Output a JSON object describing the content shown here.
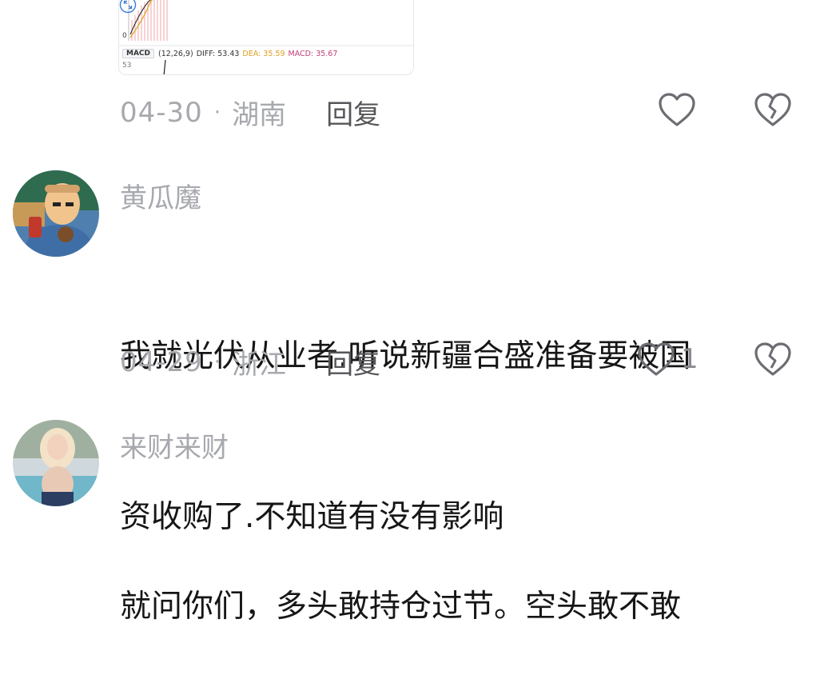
{
  "chart_card": {
    "zero_label": "0",
    "macd_tag": "MACD",
    "macd_params": "(12,26,9)",
    "diff_text": "DIFF: 53.43",
    "dea_text": "DEA: 35.59",
    "macd_text": "MACD: 35.67",
    "low_label": "53"
  },
  "comments": [
    {
      "date": "04-30",
      "location": "湖南",
      "reply_label": "回复"
    },
    {
      "username": "黄瓜魔",
      "text_line1": "我就光伏从业者.听说新疆合盛准备要被国",
      "text_line2": "资收购了.不知道有没有影响",
      "date": "04-29",
      "location": "浙江",
      "reply_label": "回复",
      "like_count": "1"
    },
    {
      "username": "来财来财",
      "text_line1": "就问你们，多头敢持仓过节。空头敢不敢"
    }
  ],
  "separator": "·",
  "colors": {
    "meta_gray": "#a7a9ae",
    "text": "#161616",
    "reply": "#555659",
    "heart_outline": "#6b6d72"
  }
}
